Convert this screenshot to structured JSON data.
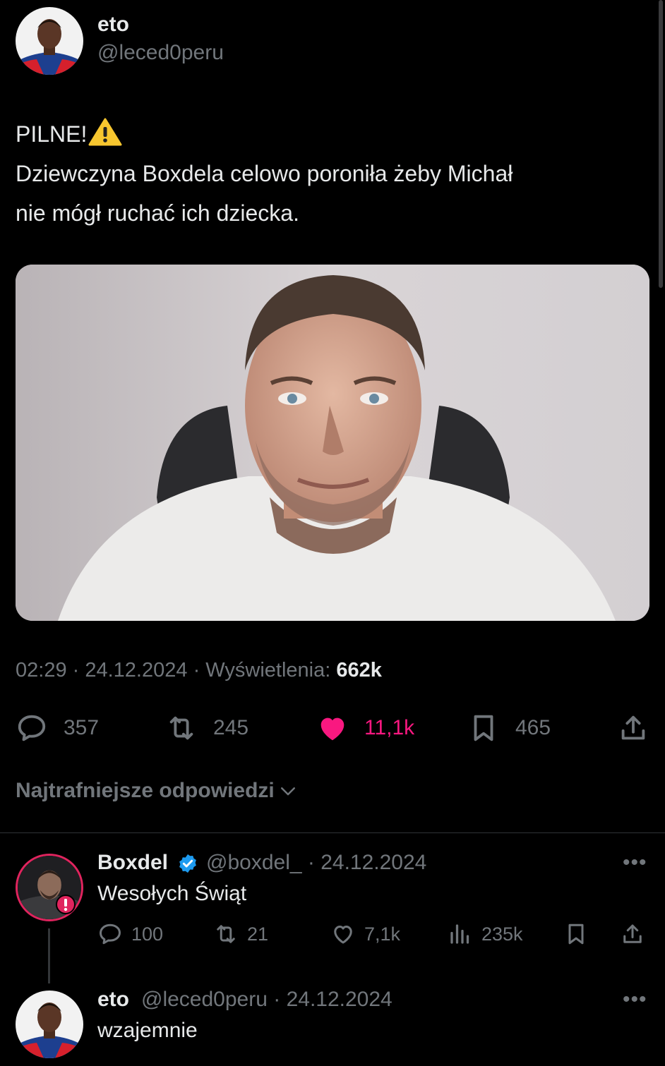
{
  "tweet": {
    "author_name": "eto",
    "author_handle": "@leced0peru",
    "text_line1": "PILNE!",
    "text_line2": "Dziewczyna Boxdela celowo poroniła żeby Michał",
    "text_line3": "nie mógł ruchać ich dziecka.",
    "warning_icon": "warning-emoji",
    "time": "02:29",
    "date": "24.12.2024",
    "views_label": "Wyświetlenia:",
    "views_count": "662k",
    "replies": "357",
    "retweets": "245",
    "likes": "11,1k",
    "bookmarks": "465"
  },
  "replies_section": {
    "sort_label": "Najtrafniejsze odpowiedzi"
  },
  "reply1": {
    "name": "Boxdel",
    "handle": "@boxdel_",
    "date": "· 24.12.2024",
    "text": "Wesołych Świąt",
    "replies": "100",
    "retweets": "21",
    "likes": "7,1k",
    "views": "235k",
    "more": "•••"
  },
  "reply2": {
    "name": "eto",
    "handle": "@leced0peru",
    "date": "· 24.12.2024",
    "text": "wzajemnie",
    "more": "•••"
  },
  "colors": {
    "background": "#000000",
    "text_primary": "#e7e9ea",
    "text_secondary": "#71767b",
    "like_active": "#f91880",
    "verified": "#1d9bf0",
    "avatar_ring": "#e0245e"
  }
}
